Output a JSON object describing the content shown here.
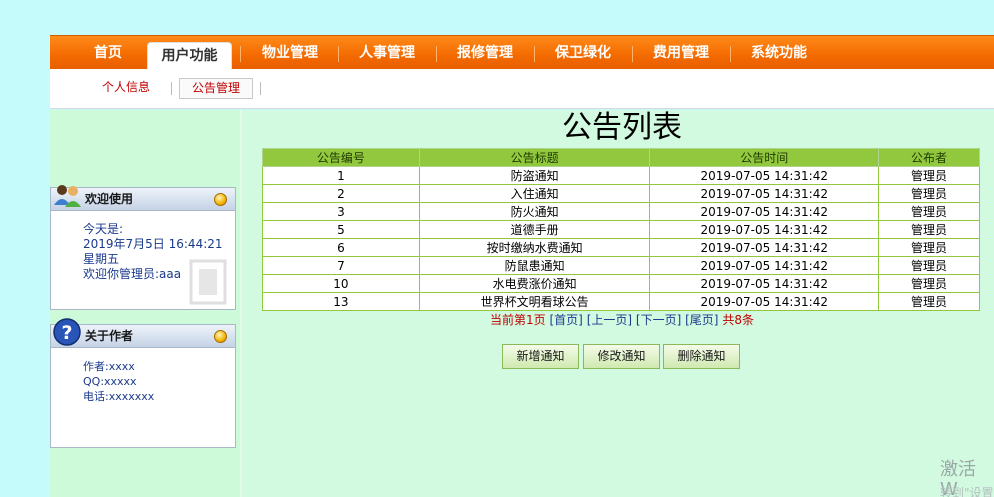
{
  "topnav": {
    "tabs": [
      "首页",
      "用户功能",
      "物业管理",
      "人事管理",
      "报修管理",
      "保卫绿化",
      "费用管理",
      "系统功能"
    ],
    "active_index": 1
  },
  "subnav": {
    "items": [
      "个人信息",
      "公告管理"
    ],
    "active_index": 1
  },
  "welcome_box": {
    "title": "欢迎使用",
    "line1": "今天是:",
    "date": "2019年7月5日  16:44:21",
    "weekday": "星期五",
    "greeting": "欢迎你管理员:aaa"
  },
  "about_box": {
    "title": "关于作者",
    "author": "作者:xxxx",
    "qq": "QQ:xxxxx",
    "phone": "电话:xxxxxxx"
  },
  "main": {
    "title": "公告列表",
    "columns": [
      "公告编号",
      "公告标题",
      "公告时间",
      "公布者"
    ],
    "rows": [
      [
        "1",
        "防盗通知",
        "2019-07-05 14:31:42",
        "管理员"
      ],
      [
        "2",
        "入住通知",
        "2019-07-05 14:31:42",
        "管理员"
      ],
      [
        "3",
        "防火通知",
        "2019-07-05 14:31:42",
        "管理员"
      ],
      [
        "5",
        "道德手册",
        "2019-07-05 14:31:42",
        "管理员"
      ],
      [
        "6",
        "按时缴纳水费通知",
        "2019-07-05 14:31:42",
        "管理员"
      ],
      [
        "7",
        "防鼠患通知",
        "2019-07-05 14:31:42",
        "管理员"
      ],
      [
        "10",
        "水电费涨价通知",
        "2019-07-05 14:31:42",
        "管理员"
      ],
      [
        "13",
        "世界杯文明看球公告",
        "2019-07-05 14:31:42",
        "管理员"
      ]
    ],
    "pager": {
      "current": "当前第1页",
      "first": "[首页]",
      "prev": "[上一页]",
      "next": "[下一页]",
      "last": "[尾页]",
      "total": "共8条"
    },
    "buttons": {
      "add": "新增通知",
      "edit": "修改通知",
      "delete": "删除通知"
    }
  },
  "watermark": {
    "line1": "激活 W",
    "line2": "转到\"设置"
  },
  "colors": {
    "nav_orange": "#f36a00",
    "table_header": "#92c83e",
    "link_red": "#c00000",
    "link_blue": "#1a3a8c"
  }
}
